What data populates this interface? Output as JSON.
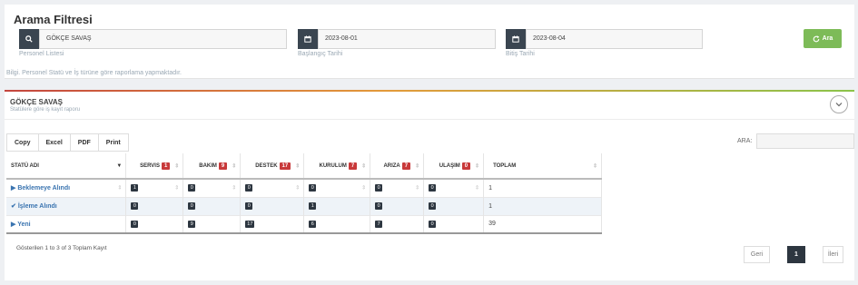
{
  "filter": {
    "title": "Arama Filtresi",
    "personnel": {
      "value": "GÖKÇE SAVAŞ",
      "caption": "Personel Listesi",
      "icon": "search-icon"
    },
    "start_date": {
      "value": "2023-08-01",
      "caption": "Başlangıç Tarihi",
      "icon": "calendar-icon"
    },
    "end_date": {
      "value": "2023-08-04",
      "caption": "Bitiş Tarihi",
      "icon": "calendar-icon"
    },
    "search_button": "Ara",
    "info": "Bilgi. Personel Statü ve İş türüne göre raporlama yapmaktadır."
  },
  "report": {
    "title": "GÖKÇE SAVAŞ",
    "subtitle": "Statülere göre iş kayıt raporu",
    "export_buttons": [
      "Copy",
      "Excel",
      "PDF",
      "Print"
    ],
    "search_label": "ARA:",
    "columns": [
      {
        "label": "STATÜ ADI",
        "badge": ""
      },
      {
        "label": "SERVIS",
        "badge": "1"
      },
      {
        "label": "BAKIM",
        "badge": "9"
      },
      {
        "label": "DESTEK",
        "badge": "17"
      },
      {
        "label": "KURULUM",
        "badge": "7"
      },
      {
        "label": "ARIZA",
        "badge": "7"
      },
      {
        "label": "ULAŞIM",
        "badge": "0"
      },
      {
        "label": "TOPLAM",
        "badge": ""
      }
    ],
    "rows": [
      {
        "status": "Beklemeye Alındı",
        "icon": "triangle-right-icon",
        "values": [
          "1",
          "0",
          "0",
          "0",
          "0",
          "0"
        ],
        "total": "1"
      },
      {
        "status": "İşleme Alındı",
        "icon": "check-icon",
        "values": [
          "0",
          "0",
          "0",
          "1",
          "0",
          "0"
        ],
        "total": "1"
      },
      {
        "status": "Yeni",
        "icon": "triangle-right-icon",
        "values": [
          "0",
          "9",
          "17",
          "6",
          "7",
          "0"
        ],
        "total": "39"
      }
    ],
    "summary": "Gösterilen 1 to 3 of 3 Toplam Kayıt",
    "pager": {
      "prev": "Geri",
      "page": "1",
      "next": "İleri"
    }
  },
  "colors": {
    "accent_green": "#7dbb58",
    "badge_red": "#c8393a",
    "dark": "#2d3640",
    "link_blue": "#3a74b0"
  }
}
